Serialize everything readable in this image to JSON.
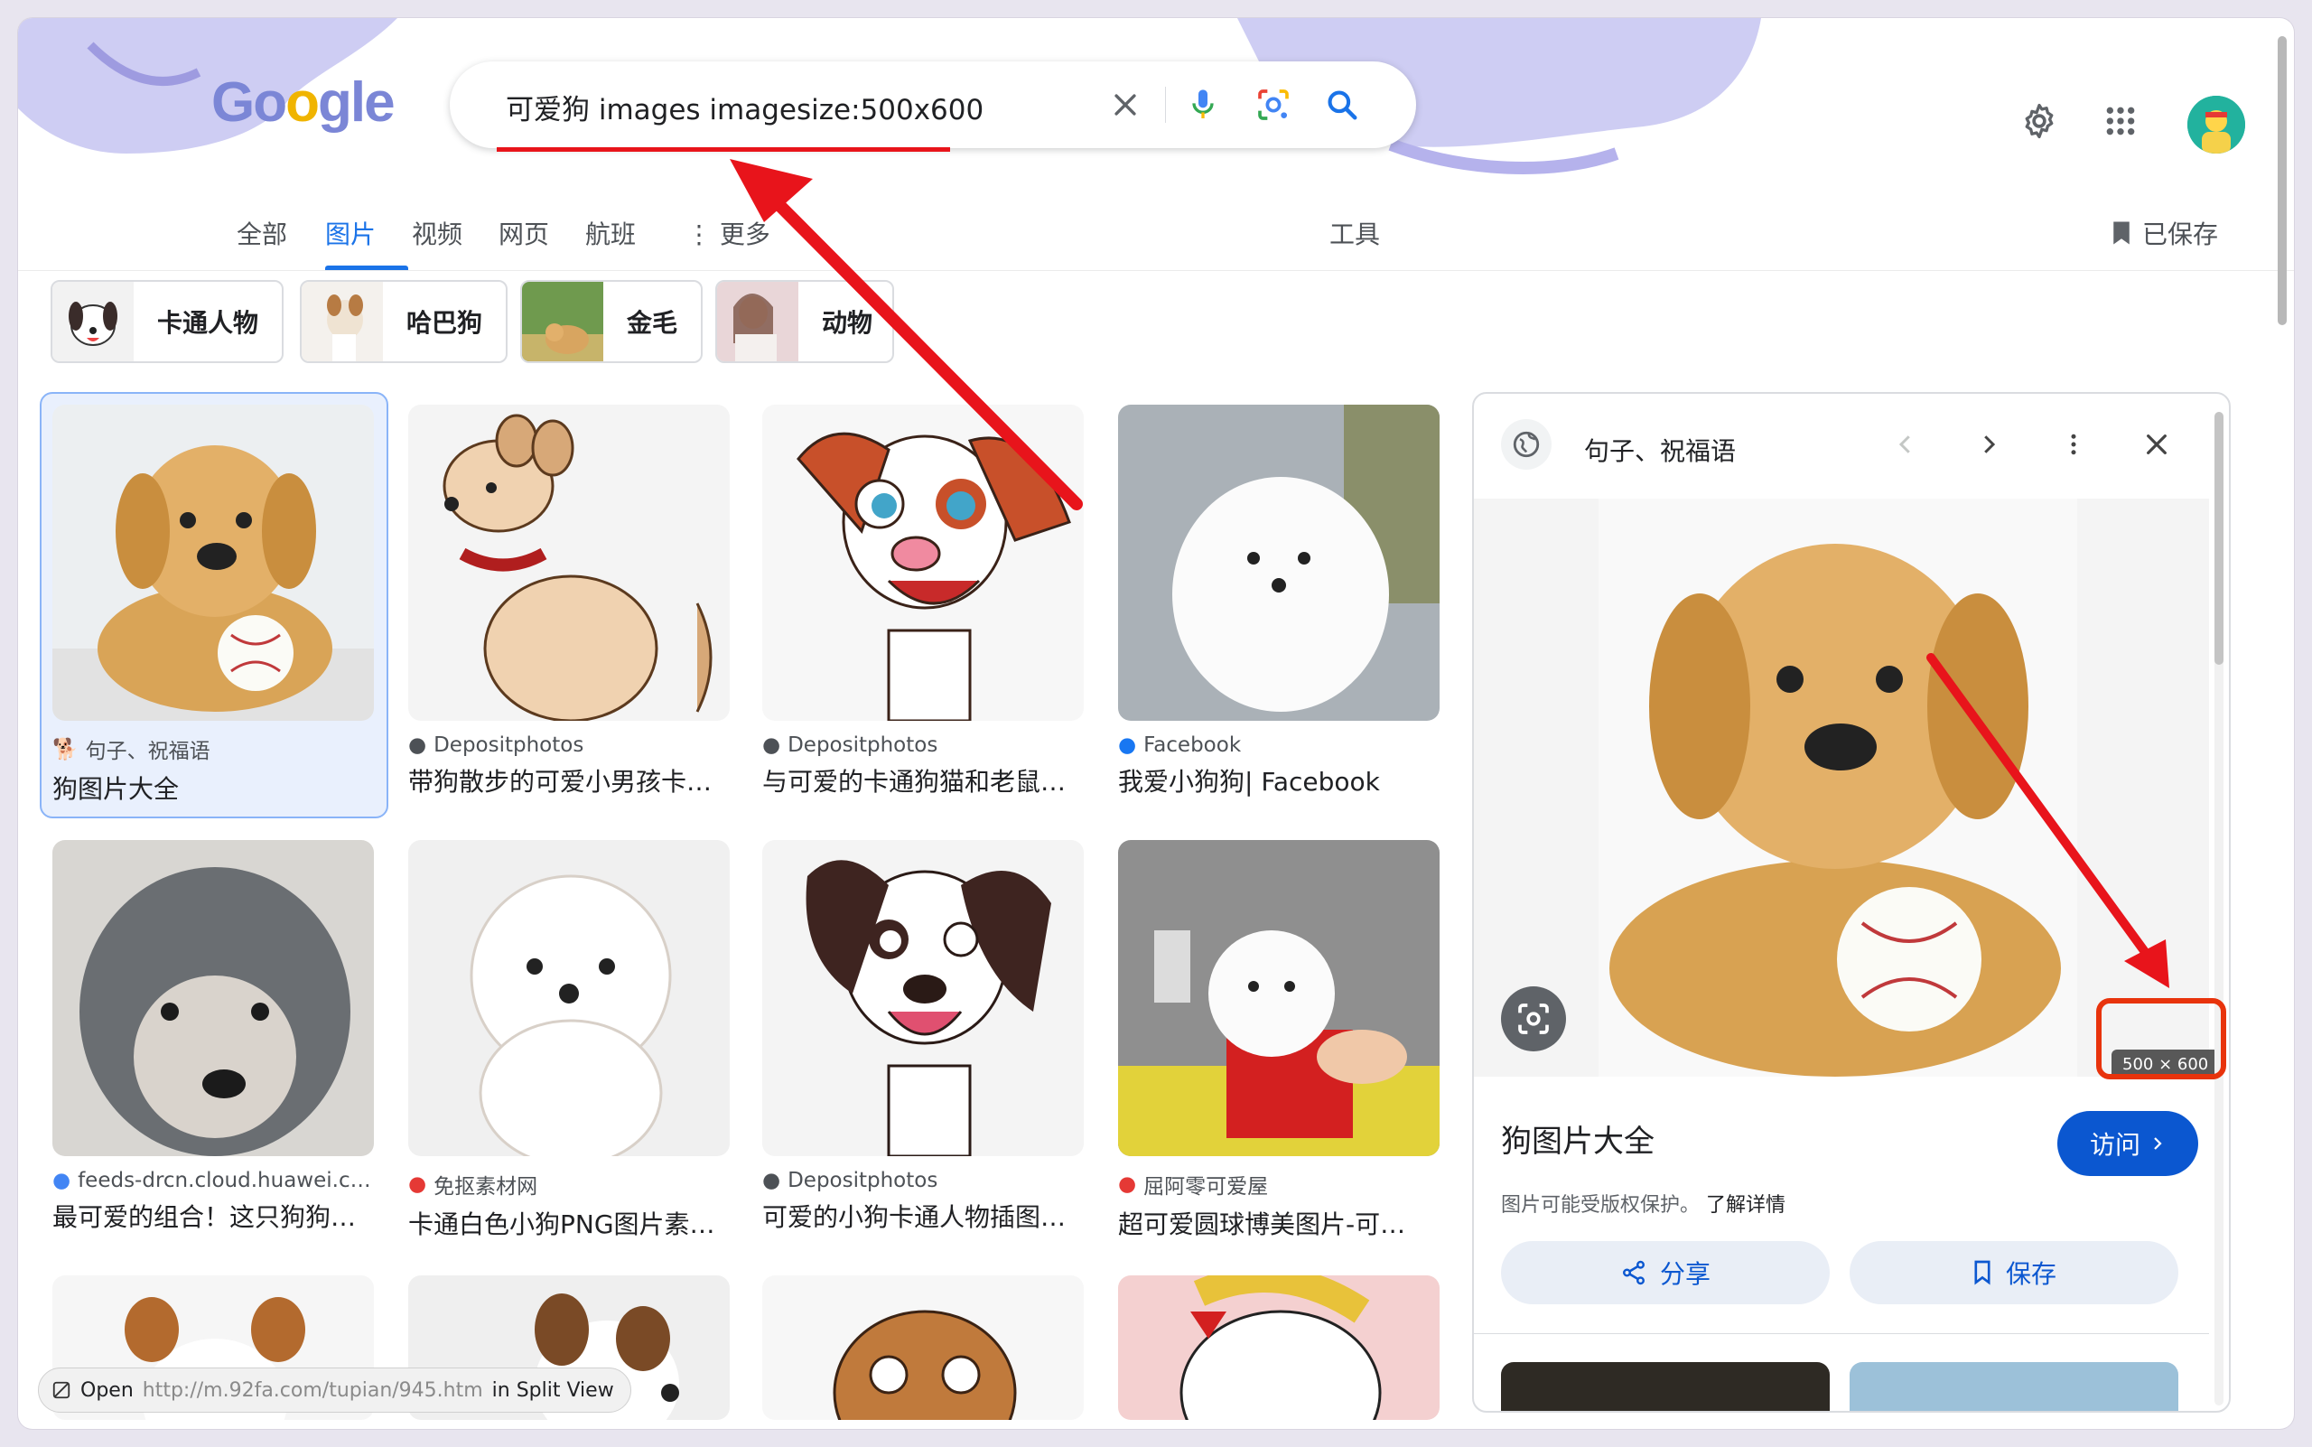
{
  "search": {
    "query": "可爱狗 images imagesize:500x600"
  },
  "logo_text": [
    "G",
    "o",
    "o",
    "g",
    "l",
    "e"
  ],
  "tabs": [
    {
      "label": "全部",
      "active": false
    },
    {
      "label": "图片",
      "active": true
    },
    {
      "label": "视频",
      "active": false
    },
    {
      "label": "网页",
      "active": false
    },
    {
      "label": "航班",
      "active": false
    },
    {
      "label": "更多",
      "active": false
    }
  ],
  "tools_label": "工具",
  "saved_label": "已保存",
  "chips": [
    {
      "label": "卡通人物"
    },
    {
      "label": "哈巴狗"
    },
    {
      "label": "金毛"
    },
    {
      "label": "动物"
    }
  ],
  "results": [
    {
      "source": "句子、祝福语",
      "title": "狗图片大全"
    },
    {
      "source": "Depositphotos",
      "title": "带狗散步的可爱小男孩卡…"
    },
    {
      "source": "Depositphotos",
      "title": "与可爱的卡通狗猫和老鼠…"
    },
    {
      "source": "Facebook",
      "title": "我爱小狗狗| Facebook"
    },
    {
      "source": "feeds-drcn.cloud.huawei.c…",
      "title": "最可爱的组合！这只狗狗…"
    },
    {
      "source": "免抠素材网",
      "title": "卡通白色小狗PNG图片素…"
    },
    {
      "source": "Depositphotos",
      "title": "可爱的小狗卡通人物插图…"
    },
    {
      "source": "屈阿零可爱屋",
      "title": "超可爱圆球博美图片-可…"
    }
  ],
  "panel": {
    "source": "句子、祝福语",
    "size_badge": "500 × 600",
    "title": "狗图片大全",
    "visit_label": "访问",
    "note": "图片可能受版权保护。",
    "learn_more": "了解详情",
    "share_label": "分享",
    "save_label": "保存"
  },
  "status": {
    "prefix": "Open",
    "url": "http://m.92fa.com/tupian/945.htm",
    "suffix": "in Split View"
  },
  "colors": {
    "accent": "#1a73e8",
    "annotation_red": "#e8141b"
  }
}
